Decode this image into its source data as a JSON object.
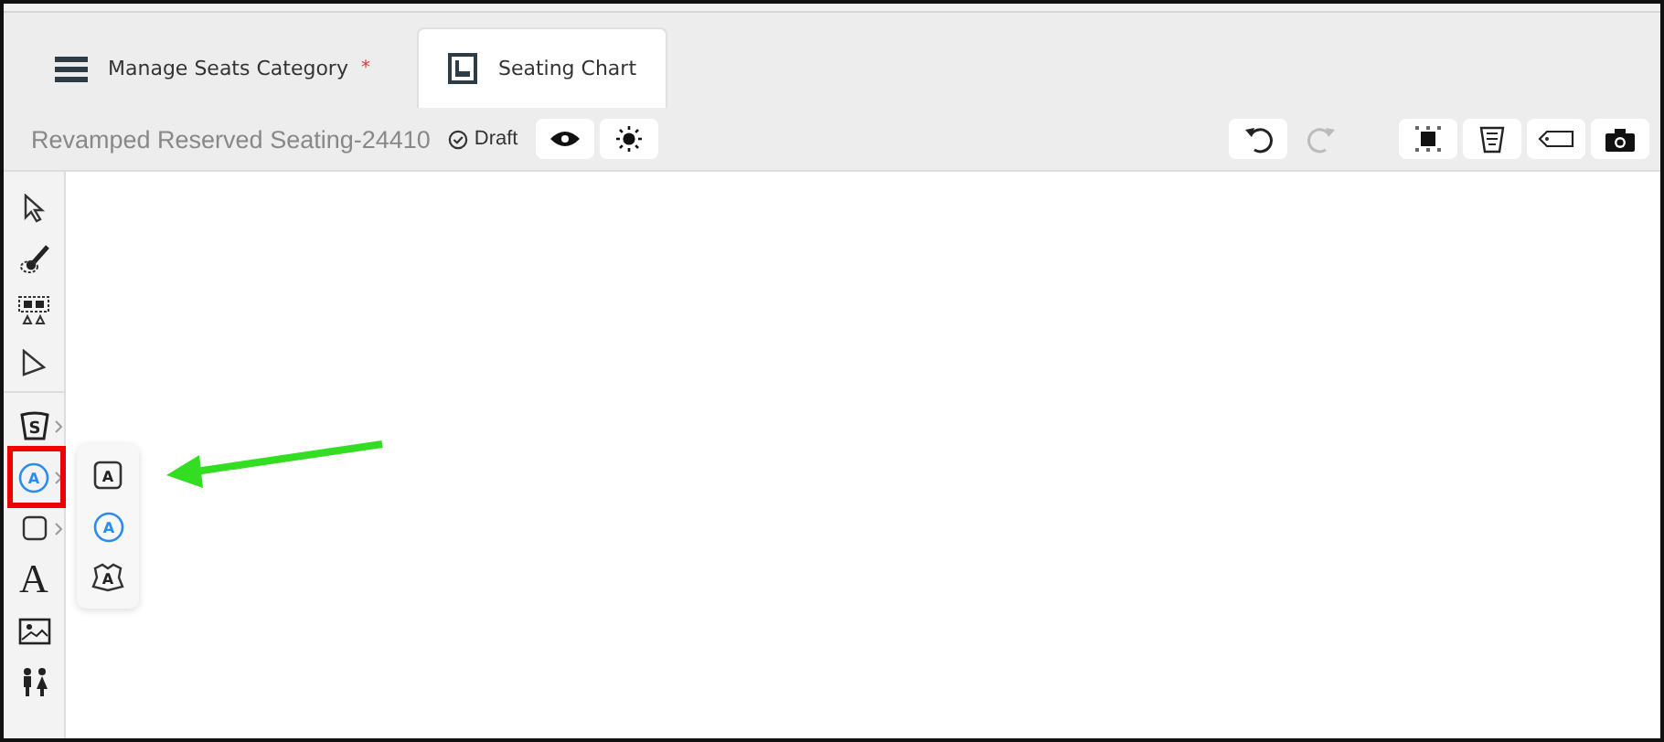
{
  "tabs": [
    {
      "label": "Manage Seats Category",
      "selected": false,
      "unsaved_mark": "*"
    },
    {
      "label": "Seating Chart",
      "selected": true
    }
  ],
  "toolbar": {
    "title": "Revamped Reserved Seating-24410",
    "status": "Draft",
    "view_buttons": [
      {
        "kind": "eye"
      },
      {
        "kind": "sun"
      }
    ],
    "history_buttons": [
      {
        "kind": "undo",
        "disabled": false
      },
      {
        "kind": "redo",
        "disabled": true
      }
    ],
    "action_buttons": [
      {
        "kind": "select-all"
      },
      {
        "kind": "delete"
      },
      {
        "kind": "tag"
      },
      {
        "kind": "camera"
      }
    ]
  },
  "tools": [
    {
      "kind": "select"
    },
    {
      "kind": "brush"
    },
    {
      "kind": "seats"
    },
    {
      "kind": "pointer"
    },
    {
      "kind": "section",
      "glyph": "S",
      "has_submenu": true,
      "highlighted": false
    },
    {
      "kind": "circle-label",
      "glyph": "A",
      "has_submenu": true,
      "highlighted": true
    },
    {
      "kind": "shape",
      "has_submenu": true,
      "highlighted": false
    },
    {
      "kind": "text",
      "glyph": "A"
    },
    {
      "kind": "image"
    },
    {
      "kind": "people"
    }
  ],
  "flyout": [
    {
      "kind": "square",
      "glyph": "A"
    },
    {
      "kind": "circle",
      "glyph": "A"
    },
    {
      "kind": "badge",
      "glyph": "A"
    }
  ]
}
